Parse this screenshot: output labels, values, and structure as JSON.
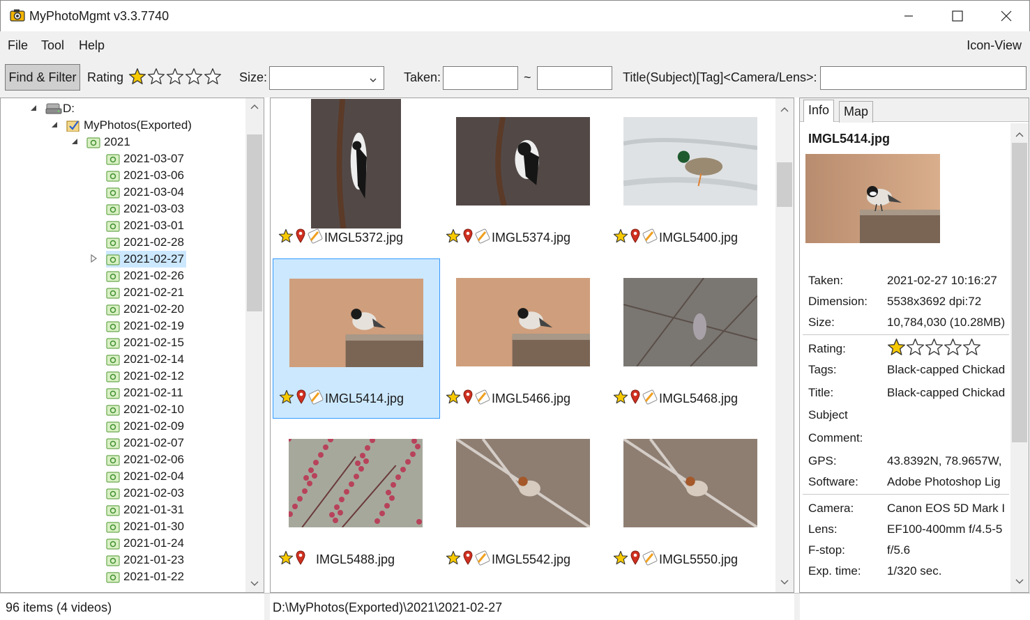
{
  "window": {
    "title": "MyPhotoMgmt v3.3.7740"
  },
  "menu": {
    "file": "File",
    "tool": "Tool",
    "help": "Help",
    "view_mode": "Icon-View"
  },
  "toolbar": {
    "find_filter_label": "Find & Filter",
    "rating_label": "Rating",
    "rating_value": 1,
    "rating_max": 5,
    "size_label": "Size:",
    "size_value": "",
    "taken_label": "Taken:",
    "taken_from": "",
    "range_sep": "~",
    "taken_to": "",
    "query_label": "Title(Subject)[Tag]<Camera/Lens>:",
    "query_value": ""
  },
  "tree": {
    "drive": "D:",
    "root_folder": "MyPhotos(Exported)",
    "year": "2021",
    "dates": [
      "2021-03-07",
      "2021-03-06",
      "2021-03-04",
      "2021-03-03",
      "2021-03-01",
      "2021-02-28",
      "2021-02-27",
      "2021-02-26",
      "2021-02-21",
      "2021-02-20",
      "2021-02-19",
      "2021-02-15",
      "2021-02-14",
      "2021-02-12",
      "2021-02-11",
      "2021-02-10",
      "2021-02-09",
      "2021-02-07",
      "2021-02-06",
      "2021-02-04",
      "2021-02-03",
      "2021-01-31",
      "2021-01-30",
      "2021-01-24",
      "2021-01-23",
      "2021-01-22"
    ],
    "selected_date": "2021-02-27"
  },
  "thumbnails": [
    {
      "file": "IMGL5372.jpg",
      "subject": "woodpecker",
      "selected": false
    },
    {
      "file": "IMGL5374.jpg",
      "subject": "woodpecker",
      "selected": false
    },
    {
      "file": "IMGL5400.jpg",
      "subject": "duck",
      "selected": false
    },
    {
      "file": "IMGL5414.jpg",
      "subject": "chickadee",
      "selected": true
    },
    {
      "file": "IMGL5466.jpg",
      "subject": "chickadee",
      "selected": false
    },
    {
      "file": "IMGL5468.jpg",
      "subject": "dove",
      "selected": false
    },
    {
      "file": "IMGL5488.jpg",
      "subject": "berries",
      "selected": false
    },
    {
      "file": "IMGL5542.jpg",
      "subject": "sparrow",
      "selected": false
    },
    {
      "file": "IMGL5550.jpg",
      "subject": "sparrow",
      "selected": false
    }
  ],
  "info_panel": {
    "tab_info": "Info",
    "tab_map": "Map",
    "filename": "IMGL5414.jpg",
    "taken_label": "Taken:",
    "taken": "2021-02-27 10:16:27",
    "dimension_label": "Dimension:",
    "dimension": "5538x3692 dpi:72",
    "size_label": "Size:",
    "size": "10,784,030 (10.28MB)",
    "rating_label": "Rating:",
    "rating_value": 1,
    "tags_label": "Tags:",
    "tags": "Black-capped Chickad",
    "title_label": "Title:",
    "title": "Black-capped Chickad",
    "subject_label": "Subject",
    "comment_label": "Comment:",
    "gps_label": "GPS:",
    "gps": "43.8392N, 78.9657W,",
    "software_label": "Software:",
    "software": "Adobe Photoshop Lig",
    "camera_label": "Camera:",
    "camera": "Canon EOS 5D Mark I",
    "lens_label": "Lens:",
    "lens": "EF100-400mm f/4.5-5",
    "fstop_label": "F-stop:",
    "fstop": "f/5.6",
    "exptime_label": "Exp. time:",
    "exptime": "1/320 sec."
  },
  "status": {
    "item_count": "96 items (4 videos)",
    "path": "D:\\MyPhotos(Exported)\\2021\\2021-02-27"
  },
  "colors": {
    "star": "#f7c900",
    "selection": "#cce8ff",
    "selection_border": "#3399ff",
    "pin": "#d03020"
  }
}
